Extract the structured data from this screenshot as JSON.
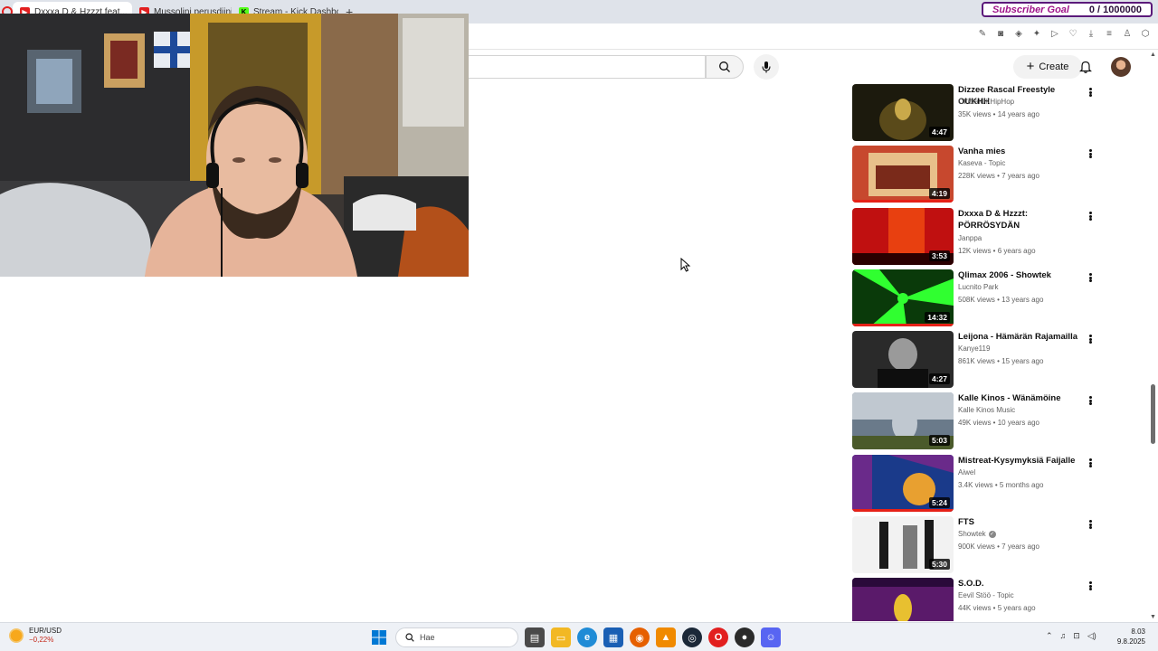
{
  "tabs": [
    {
      "label": "Dxxxa D & Hzzzt feat...",
      "icon": "youtube-icon",
      "active": true
    },
    {
      "label": "Mussolini perusdiini - You...",
      "icon": "youtube-icon",
      "active": false
    },
    {
      "label": "Stream - Kick Dashboard",
      "icon": "kick-icon",
      "active": false
    }
  ],
  "new_tab_symbol": "+",
  "subscriber_goal": {
    "label": "Subscriber Goal",
    "count": "0 / 1000000"
  },
  "masthead": {
    "create_label": "Create"
  },
  "videos": [
    {
      "title": "Dizzee Rascal Freestyle OUKHH",
      "channel": "OfficialUKHipHop",
      "meta": "35K views • 14 years ago",
      "duration": "4:47",
      "verified": false,
      "watched": 0,
      "palette": [
        "#1c1a0d",
        "#5a4a1a",
        "#c9a94a"
      ]
    },
    {
      "title": "Vanha mies",
      "channel": "Kaseva - Topic",
      "meta": "228K views • 7 years ago",
      "duration": "4:19",
      "verified": false,
      "watched": 1,
      "palette": [
        "#c7482e",
        "#e8c08a",
        "#7a2a1a"
      ]
    },
    {
      "title": "Dxxxa D & Hzzzt: PÖRRÖSYDÄN",
      "channel": "Janppa",
      "meta": "12K views • 6 years ago",
      "duration": "3:53",
      "verified": false,
      "watched": 0,
      "palette": [
        "#c01010",
        "#e84010",
        "#2a0000"
      ]
    },
    {
      "title": "Qlimax 2006 - Showtek",
      "channel": "Lucnito Park",
      "meta": "508K views • 13 years ago",
      "duration": "14:32",
      "verified": false,
      "watched": 1,
      "palette": [
        "#0a3a0a",
        "#30ff30",
        "#001a00"
      ]
    },
    {
      "title": "Leijona - Hämärän Rajamailla",
      "channel": "Kanye119",
      "meta": "861K views • 15 years ago",
      "duration": "4:27",
      "verified": false,
      "watched": 0,
      "palette": [
        "#2a2a2a",
        "#9a9a9a",
        "#0e0e0e"
      ]
    },
    {
      "title": "Kalle Kinos - Wänämöine",
      "channel": "Kalle Kinos Music",
      "meta": "49K views • 10 years ago",
      "duration": "5:03",
      "verified": false,
      "watched": 0,
      "palette": [
        "#6a7a8a",
        "#c0c8d0",
        "#4a5a2a"
      ]
    },
    {
      "title": "Mistreat-Kysymyksiä Faijalle",
      "channel": "Aiwel",
      "meta": "3.4K views • 5 months ago",
      "duration": "5:24",
      "verified": false,
      "watched": 1,
      "palette": [
        "#1a3a8a",
        "#e8a030",
        "#6a2a8a"
      ]
    },
    {
      "title": "FTS",
      "channel": "Showtek",
      "meta": "900K views • 7 years ago",
      "duration": "5:30",
      "verified": true,
      "watched": 0,
      "palette": [
        "#f2f2f2",
        "#1a1a1a",
        "#7a7a7a"
      ]
    },
    {
      "title": "S.O.D.",
      "channel": "Eevil Stöö - Topic",
      "meta": "44K views • 5 years ago",
      "duration": "",
      "verified": false,
      "watched": 0,
      "palette": [
        "#5a1a6a",
        "#e8c030",
        "#2a0a3a"
      ]
    }
  ],
  "taskbar": {
    "ticker_symbol": "EUR/USD",
    "ticker_change": "−0,22%",
    "search_placeholder": "Hae",
    "time": "8.03",
    "date": "9.8.2025"
  },
  "colors": {
    "accent_red": "#e62117",
    "goal_purple": "#a0158a",
    "kick_green": "#53fc18"
  }
}
